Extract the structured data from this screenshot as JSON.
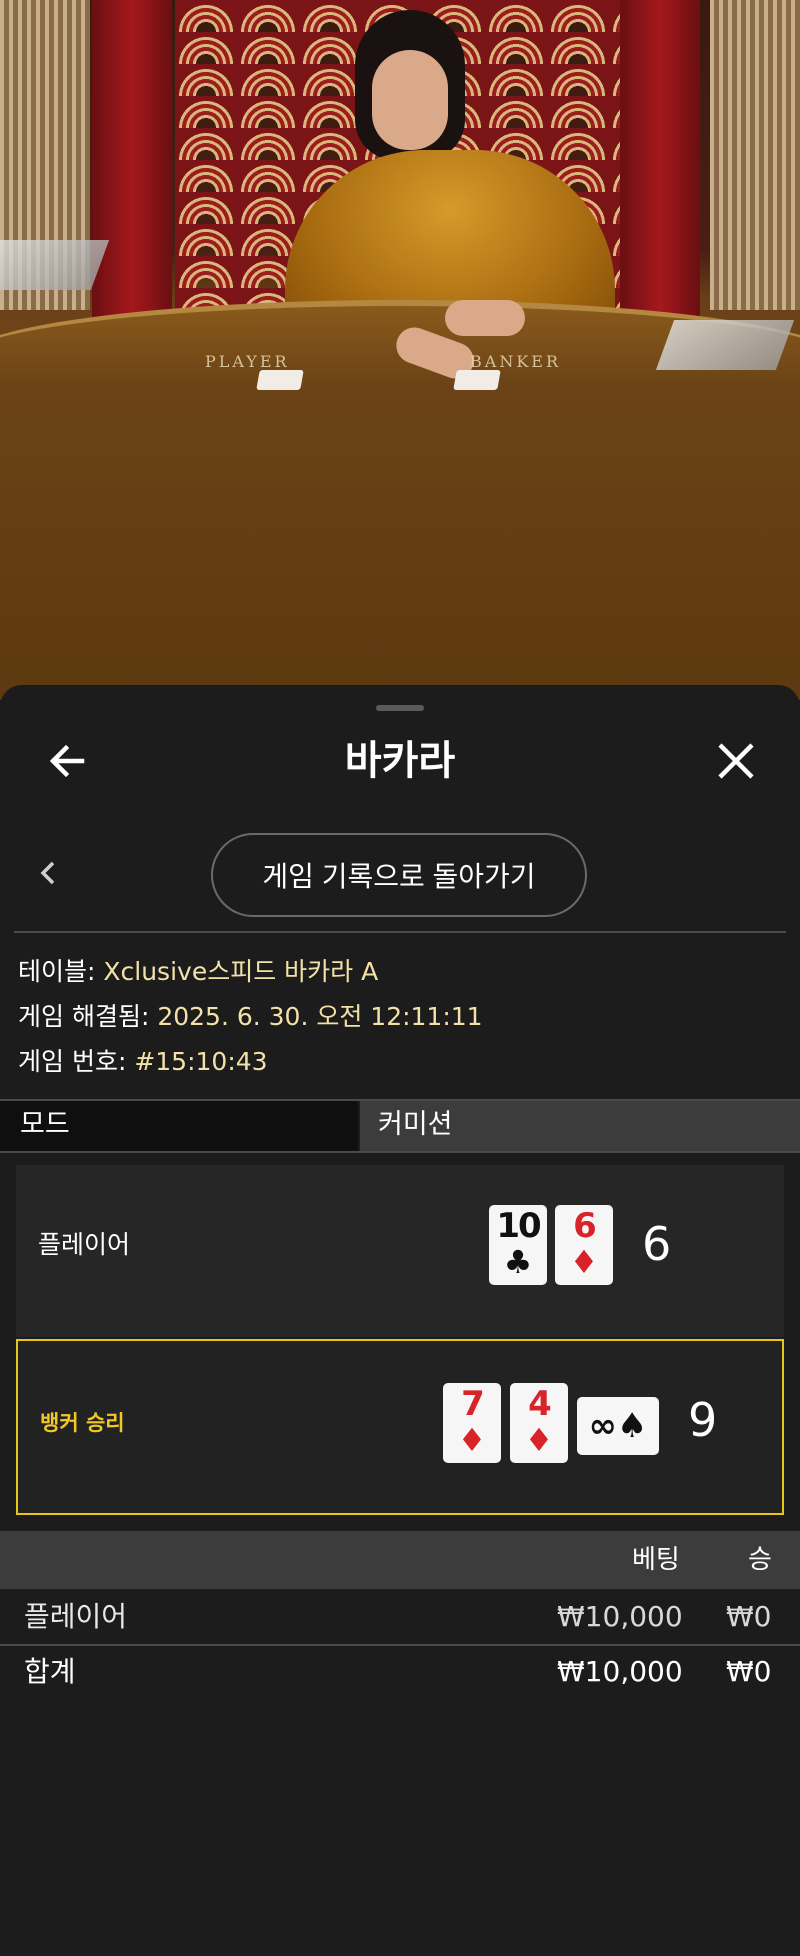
{
  "video": {
    "felt_player": "PLAYER",
    "felt_banker": "BANKER"
  },
  "header": {
    "title": "바카라",
    "back_icon": "arrow-left-icon",
    "close_icon": "close-x-icon"
  },
  "subnav": {
    "back_icon": "chevron-left-icon",
    "return_button": "게임 기록으로 돌아가기"
  },
  "game_info": {
    "table_label": "테이블:",
    "table_value": "Xclusive스피드 바카라 A",
    "resolved_label": "게임 해결됨:",
    "resolved_value": "2025. 6. 30. 오전 12:11:11",
    "number_label": "게임 번호:",
    "number_value": "#15:10:43"
  },
  "tabs": {
    "mode": "모드",
    "commission": "커미션"
  },
  "hands": {
    "player": {
      "label": "플레이어",
      "cards": [
        {
          "rank": "10",
          "suit": "♣",
          "color": "#111111"
        },
        {
          "rank": "6",
          "suit": "♦",
          "color": "#d8232a"
        }
      ],
      "score": "6"
    },
    "banker": {
      "label": "뱅커 승리",
      "cards": [
        {
          "rank": "7",
          "suit": "♦",
          "color": "#d8232a"
        },
        {
          "rank": "4",
          "suit": "♦",
          "color": "#d8232a"
        },
        {
          "rank": "∞",
          "suit": "♠",
          "color": "#111111",
          "sideways": true
        }
      ],
      "score": "9",
      "highlight_color": "#e6c619"
    }
  },
  "bets": {
    "col_bet": "베팅",
    "col_win": "승",
    "rows": [
      {
        "name": "플레이어",
        "bet": "₩10,000",
        "win": "₩0"
      }
    ],
    "total": {
      "name": "합계",
      "bet": "₩10,000",
      "win": "₩0"
    }
  }
}
